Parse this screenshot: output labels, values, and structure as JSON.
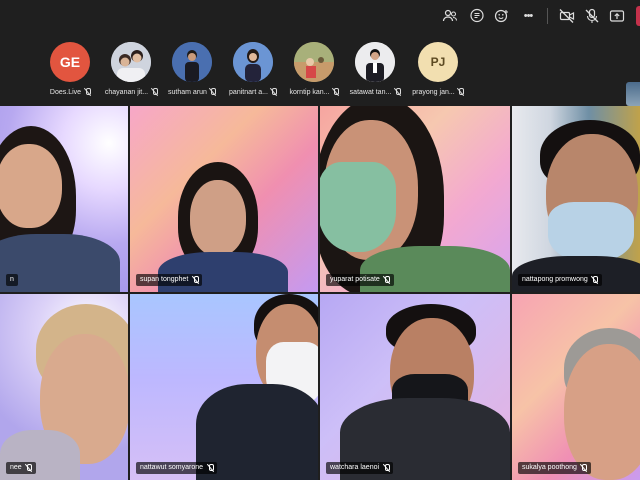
{
  "toolbar": {
    "icons": [
      "people-icon",
      "chat-icon",
      "react-icon",
      "more-icon",
      "camera-off-icon",
      "mic-off-icon",
      "share-icon"
    ],
    "more_label": "•••"
  },
  "participants_strip": [
    {
      "name": "Does.Live",
      "initials": "GE",
      "avatar_color": "#e2553f"
    },
    {
      "name": "chayanan jit...",
      "initials": "",
      "avatar_color": "#d9dce6"
    },
    {
      "name": "sutham arun",
      "initials": "",
      "avatar_color": "#3d5f9e"
    },
    {
      "name": "panitnart a...",
      "initials": "",
      "avatar_color": "#5b86c9"
    },
    {
      "name": "korntip kan...",
      "initials": "",
      "avatar_color": "#b79a5d"
    },
    {
      "name": "satawat tan...",
      "initials": "",
      "avatar_color": "#e8e8ea"
    },
    {
      "name": "prayong jan...",
      "initials": "PJ",
      "avatar_color": "#f2dfb0"
    }
  ],
  "video_tiles": [
    {
      "name": "n"
    },
    {
      "name": "supan tongphet"
    },
    {
      "name": "yuparat potisate"
    },
    {
      "name": "nattapong promwong"
    },
    {
      "name": "nee"
    },
    {
      "name": "nattawut somyarone"
    },
    {
      "name": "watchara laenoi"
    },
    {
      "name": "sukalya poothong"
    }
  ]
}
